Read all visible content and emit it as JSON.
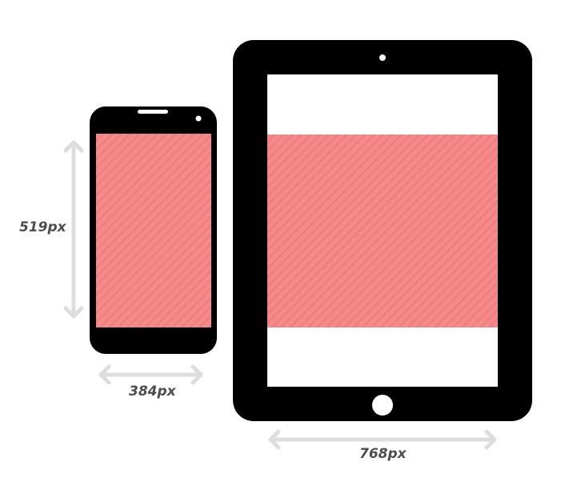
{
  "colors": {
    "device_body": "#000000",
    "viewport_fill": "#f68a8a",
    "viewport_stripe": "#f07f80",
    "screen_background": "#ffffff",
    "arrow": "#dddddd",
    "label": "#4d4d4d"
  },
  "phone": {
    "height_label": "519px",
    "width_label": "384px"
  },
  "tablet": {
    "width_label": "768px"
  }
}
